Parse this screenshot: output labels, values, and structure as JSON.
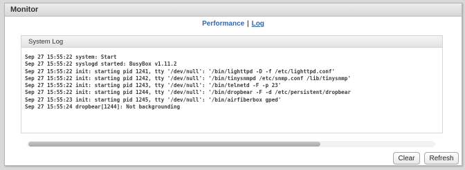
{
  "window": {
    "title": "Monitor"
  },
  "nav": {
    "links": [
      {
        "label": "Performance",
        "active": false
      },
      {
        "label": "Log",
        "active": true
      }
    ],
    "separator": "|"
  },
  "system_log": {
    "title": "System Log",
    "lines": [
      "Sep 27 15:55:22 system: Start",
      "Sep 27 15:55:22 syslogd started: BusyBox v1.11.2",
      "Sep 27 15:55:22 init: starting pid 1241, tty '/dev/null': '/bin/lighttpd -D -f /etc/lighttpd.conf'",
      "Sep 27 15:55:22 init: starting pid 1242, tty '/dev/null': '/bin/tinysnmpd /etc/snmp.conf /lib/tinysnmp'",
      "Sep 27 15:55:22 init: starting pid 1243, tty '/dev/null': '/bin/telnetd -F -p 23'",
      "Sep 27 15:55:22 init: starting pid 1244, tty '/dev/null': '/bin/dropbear -F -d /etc/persistent/dropbear",
      "Sep 27 15:55:23 init: starting pid 1245, tty '/dev/null': '/bin/airfiberbox gped'",
      "Sep 27 15:55:24 dropbear[1244]: Not backgrounding"
    ],
    "scroll_thumb_fraction": 0.72
  },
  "buttons": {
    "clear": "Clear",
    "refresh": "Refresh"
  }
}
